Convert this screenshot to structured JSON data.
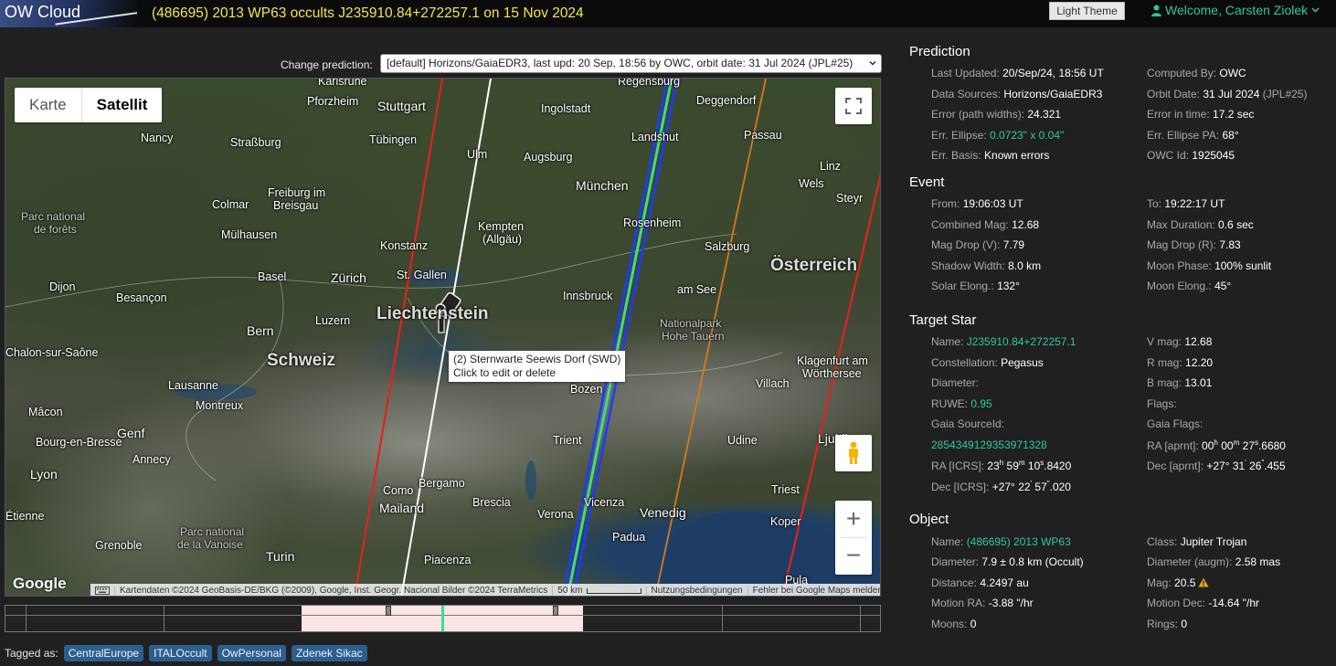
{
  "header": {
    "logo": "OW Cloud",
    "title": "(486695) 2013 WP63 occults J235910.84+272257.1 on 15 Nov 2024",
    "theme_button": "Light Theme",
    "welcome": "Welcome, Carsten Ziolek"
  },
  "prediction_select": {
    "label": "Change prediction:",
    "value": "[default] Horizons/GaiaEDR3, last upd: 20 Sep, 18:56 by OWC, orbit date: 31 Jul 2024 (JPL#25)"
  },
  "map": {
    "type_karte": "Karte",
    "type_satellit": "Satellit",
    "google": "Google",
    "attribution": "Kartendaten ©2024 GeoBasis-DE/BKG (©2009), Google, Inst. Geogr. Nacional Bilder ©2024 TerraMetrics",
    "scale": "50 km",
    "terms": "Nutzungsbedingungen",
    "report": "Fehler bei Google Maps melden",
    "tooltip_line1": "(2) Sternwarte Seewis Dorf (SWD)",
    "tooltip_line2": "Click to edit or delete",
    "zoom_in": "+",
    "zoom_out": "−",
    "labels": {
      "karlsruhe": "Karlsruhe",
      "regensburg": "Regensburg",
      "pforzheim": "Pforzheim",
      "stuttgart": "Stuttgart",
      "ingolstadt": "Ingolstadt",
      "deggendorf": "Deggendorf",
      "nancy": "Nancy",
      "strassburg": "Straßburg",
      "tuebingen": "Tübingen",
      "landshut": "Landshut",
      "passau": "Passau",
      "ulm": "Ulm",
      "augsburg": "Augsburg",
      "linz": "Linz",
      "freiburg1": "Freiburg im",
      "freiburg2": "Breisgau",
      "colmar": "Colmar",
      "muenchen": "München",
      "wels": "Wels",
      "steyr": "Steyr",
      "parc1": "Parc national",
      "parc2": "de forêts",
      "kempten1": "Kempten",
      "kempten2": "(Allgäu)",
      "rosenheim": "Rosenheim",
      "muelhausen": "Mülhausen",
      "konstanz": "Konstanz",
      "salzburg": "Salzburg",
      "basel": "Basel",
      "zuerich": "Zürich",
      "stgallen": "St. Gallen",
      "oesterreich": "Österreich",
      "dijon": "Dijon",
      "besancon": "Besançon",
      "innsbruck": "Innsbruck",
      "amsee": "am See",
      "luzern": "Luzern",
      "liechtenstein": "Liechtenstein",
      "np1": "Nationalpark",
      "np2": "Hohe Tauern",
      "bern": "Bern",
      "chalon": "Chalon-sur-Saône",
      "schweiz": "Schweiz",
      "klagenfurt1": "Klagenfurt am",
      "klagenfurt2": "Wörthersee",
      "lausanne": "Lausanne",
      "bozen": "Bozen",
      "villach": "Villach",
      "montreux": "Montreux",
      "macon": "Mâcon",
      "genf": "Genf",
      "trient": "Trient",
      "udine": "Udine",
      "ljubljana": "Ljubljana",
      "bourg": "Bourg-en-Bresse",
      "annecy": "Annecy",
      "lyon": "Lyon",
      "como": "Como",
      "bergamo": "Bergamo",
      "triest": "Triest",
      "mailand": "Mailand",
      "brescia": "Brescia",
      "verona": "Verona",
      "vicenza": "Vicenza",
      "venedig": "Venedig",
      "koper": "Koper",
      "etienne": "Étienne",
      "grenoble": "Grenoble",
      "padua": "Padua",
      "vanoise1": "Parc national",
      "vanoise2": "de la Vanoise",
      "turin": "Turin",
      "piacenza": "Piacenza",
      "pula": "Pula"
    }
  },
  "timeline": {
    "selected_fraction_start": 0.339,
    "selected_fraction_end": 0.661
  },
  "tags": {
    "label": "Tagged as:",
    "items": [
      "CentralEurope",
      "ITALOccult",
      "OwPersonal",
      "Zdenek Sikac"
    ]
  },
  "prediction": {
    "title": "Prediction",
    "last_updated_k": "Last Updated:",
    "last_updated_v": "20/Sep/24, 18:56 UT",
    "computed_by_k": "Computed By:",
    "computed_by_v": "OWC",
    "data_sources_k": "Data Sources:",
    "data_sources_v": "Horizons/GaiaEDR3",
    "orbit_date_k": "Orbit Date:",
    "orbit_date_v": "31 Jul 2024",
    "orbit_date_jpl": "(JPL#25)",
    "error_k": "Error (path widths):",
    "error_v": "24.321",
    "error_time_k": "Error in time:",
    "error_time_v": "17.2 sec",
    "err_ellipse_k": "Err. Ellipse:",
    "err_ellipse_v": "0.0723\" x 0.04\"",
    "err_ellipse_pa_k": "Err. Ellipse PA:",
    "err_ellipse_pa_v": "68°",
    "err_basis_k": "Err. Basis:",
    "err_basis_v": "Known errors",
    "owc_id_k": "OWC Id:",
    "owc_id_v": "1925045"
  },
  "event": {
    "title": "Event",
    "from_k": "From:",
    "from_v": "19:06:03 UT",
    "to_k": "To:",
    "to_v": "19:22:17 UT",
    "comb_mag_k": "Combined Mag:",
    "comb_mag_v": "12.68",
    "max_dur_k": "Max Duration:",
    "max_dur_v": "0.6 sec",
    "mag_drop_v_k": "Mag Drop (V):",
    "mag_drop_v_v": "7.79",
    "mag_drop_r_k": "Mag Drop (R):",
    "mag_drop_r_v": "7.83",
    "shadow_k": "Shadow Width:",
    "shadow_v": "8.0 km",
    "moon_phase_k": "Moon Phase:",
    "moon_phase_v": "100% sunlit",
    "solar_k": "Solar Elong.:",
    "solar_v": "132°",
    "moon_elong_k": "Moon Elong.:",
    "moon_elong_v": "45°"
  },
  "target": {
    "title": "Target Star",
    "name_k": "Name:",
    "name_v": "J235910.84+272257.1",
    "vmag_k": "V mag:",
    "vmag_v": "12.68",
    "const_k": "Constellation:",
    "const_v": "Pegasus",
    "rmag_k": "R mag:",
    "rmag_v": "12.20",
    "diam_k": "Diameter:",
    "bmag_k": "B mag:",
    "bmag_v": "13.01",
    "ruwe_k": "RUWE:",
    "ruwe_v": "0.95",
    "flags_k": "Flags:",
    "gaia_id_k": "Gaia SourceId:",
    "gaia_flags_k": "Gaia Flags:",
    "gaia_id_v": "2854349129353971328",
    "ra_aprnt_k": "RA [aprnt]:",
    "ra_aprnt_h": "00",
    "ra_aprnt_m": "00",
    "ra_aprnt_s": "27",
    "ra_aprnt_f": ".6680",
    "ra_icrs_k": "RA [ICRS]:",
    "ra_icrs_h": "23",
    "ra_icrs_m": "59",
    "ra_icrs_s": "10",
    "ra_icrs_f": ".8420",
    "dec_aprnt_k": "Dec [aprnt]:",
    "dec_aprnt_d": "+27° 31",
    "dec_aprnt_m": "26",
    "dec_aprnt_f": ".455",
    "dec_icrs_k": "Dec [ICRS]:",
    "dec_icrs_d": "+27° 22",
    "dec_icrs_m": "57",
    "dec_icrs_f": ".020"
  },
  "object": {
    "title": "Object",
    "name_k": "Name:",
    "name_v": "(486695) 2013 WP63",
    "class_k": "Class:",
    "class_v": "Jupiter Trojan",
    "diam_k": "Diameter:",
    "diam_v": "7.9 ± 0.8 km",
    "diam_src": "(Occult)",
    "diam_augm_k": "Diameter (augm):",
    "diam_augm_v": "2.58 mas",
    "dist_k": "Distance:",
    "dist_v": "4.2497 au",
    "mag_k": "Mag:",
    "mag_v": "20.5",
    "mra_k": "Motion RA:",
    "mra_v": "-3.88 \"/hr",
    "mdec_k": "Motion Dec:",
    "mdec_v": "-14.64 \"/hr",
    "moons_k": "Moons:",
    "moons_v": "0",
    "rings_k": "Rings:",
    "rings_v": "0"
  },
  "colors": {
    "accent": "#2ec7a3",
    "title_yellow": "#f2e64a",
    "central_line": "#3ddc97",
    "limit_blue": "#1a3cff",
    "sigma_red": "#e0231c",
    "error_orange": "#d7791a"
  }
}
